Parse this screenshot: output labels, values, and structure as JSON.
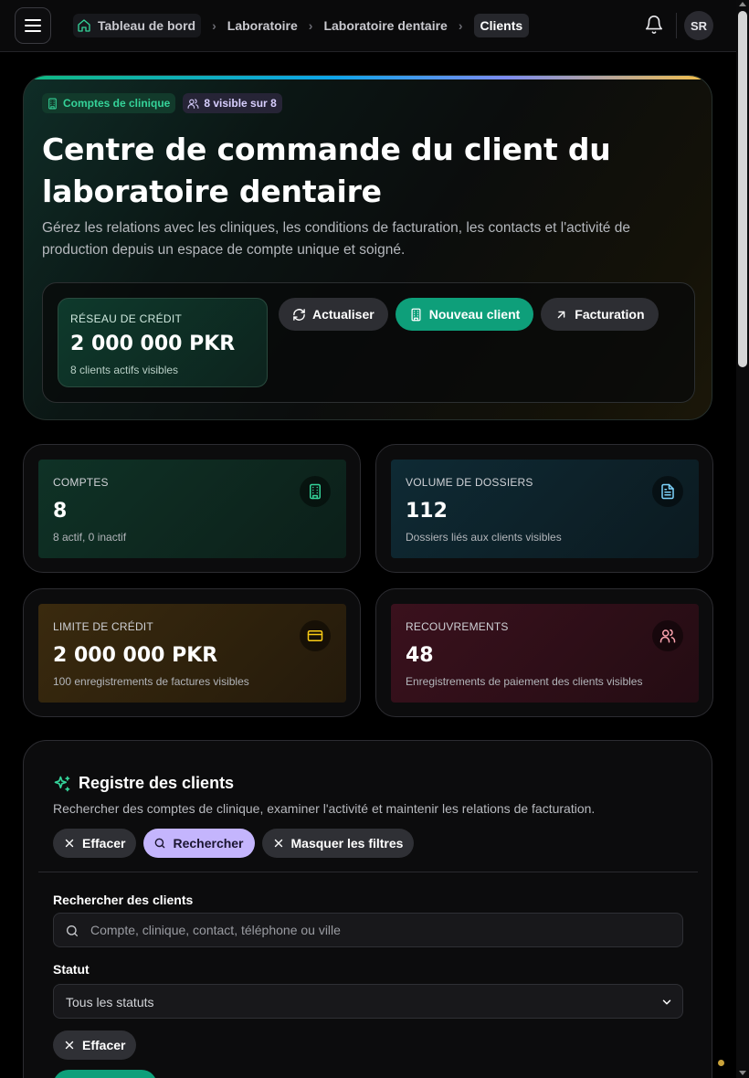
{
  "header": {
    "breadcrumbs": [
      "Tableau de bord",
      "Laboratoire",
      "Laboratoire dentaire",
      "Clients"
    ],
    "user_initials": "SR"
  },
  "hero": {
    "chip_accounts": "Comptes de clinique",
    "chip_visible": "8 visible sur 8",
    "title": "Centre de commande du client du laboratoire dentaire",
    "description": "Gérez les relations avec les cliniques, les conditions de facturation, les contacts et l'activité de production depuis un espace de compte unique et soigné.",
    "credit": {
      "label": "RÉSEAU DE CRÉDIT",
      "value": "2 000 000 PKR",
      "sub": "8 clients actifs visibles"
    },
    "buttons": {
      "refresh": "Actualiser",
      "new_client": "Nouveau client",
      "billing": "Facturation"
    }
  },
  "stats": {
    "accounts": {
      "label": "COMPTES",
      "value": "8",
      "sub": "8 actif, 0 inactif"
    },
    "cases": {
      "label": "VOLUME DE DOSSIERS",
      "value": "112",
      "sub": "Dossiers liés aux clients visibles"
    },
    "credit_limit": {
      "label": "LIMITE DE CRÉDIT",
      "value": "2 000 000 PKR",
      "sub": "100 enregistrements de factures visibles"
    },
    "collections": {
      "label": "RECOUVREMENTS",
      "value": "48",
      "sub": "Enregistrements de paiement des clients visibles"
    }
  },
  "register": {
    "title": "Registre des clients",
    "description": "Rechercher des comptes de clinique, examiner l'activité et maintenir les relations de facturation.",
    "clear_label": "Effacer",
    "search_label": "Rechercher",
    "hide_filters_label": "Masquer les filtres",
    "search_field_label": "Rechercher des clients",
    "search_placeholder": "Compte, clinique, contact, téléphone ou ville",
    "status_label": "Statut",
    "status_value": "Tous les statuts",
    "clear_small_label": "Effacer"
  },
  "colors": {
    "accent_green": "#0e9f7a",
    "accent_purple": "#c4b5fd",
    "background": "#000000"
  }
}
